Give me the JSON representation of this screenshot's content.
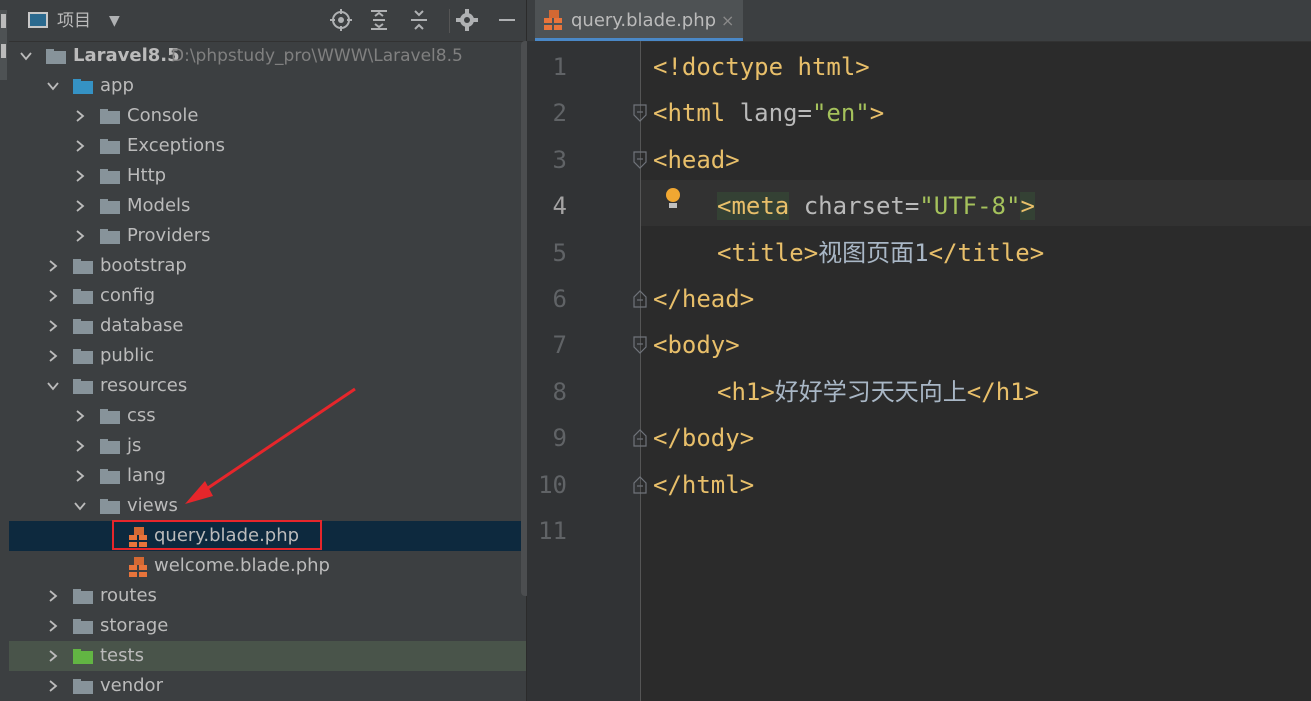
{
  "project_panel": {
    "title": "项目",
    "toolbar_icons": [
      "locate-icon",
      "expand-all-icon",
      "collapse-all-icon",
      "settings-icon",
      "hide-icon"
    ]
  },
  "tree": [
    {
      "label": "Laravel8.5",
      "path": "D:\\phpstudy_pro\\WWW\\Laravel8.5",
      "level": 0,
      "expanded": true,
      "icon": "folder",
      "bold": true
    },
    {
      "label": "app",
      "level": 1,
      "expanded": true,
      "icon": "folder-blue"
    },
    {
      "label": "Console",
      "level": 2,
      "expanded": false,
      "icon": "folder"
    },
    {
      "label": "Exceptions",
      "level": 2,
      "expanded": false,
      "icon": "folder"
    },
    {
      "label": "Http",
      "level": 2,
      "expanded": false,
      "icon": "folder"
    },
    {
      "label": "Models",
      "level": 2,
      "expanded": false,
      "icon": "folder"
    },
    {
      "label": "Providers",
      "level": 2,
      "expanded": false,
      "icon": "folder"
    },
    {
      "label": "bootstrap",
      "level": 1,
      "expanded": false,
      "icon": "folder"
    },
    {
      "label": "config",
      "level": 1,
      "expanded": false,
      "icon": "folder"
    },
    {
      "label": "database",
      "level": 1,
      "expanded": false,
      "icon": "folder"
    },
    {
      "label": "public",
      "level": 1,
      "expanded": false,
      "icon": "folder"
    },
    {
      "label": "resources",
      "level": 1,
      "expanded": true,
      "icon": "folder"
    },
    {
      "label": "css",
      "level": 2,
      "expanded": false,
      "icon": "folder"
    },
    {
      "label": "js",
      "level": 2,
      "expanded": false,
      "icon": "folder"
    },
    {
      "label": "lang",
      "level": 2,
      "expanded": false,
      "icon": "folder"
    },
    {
      "label": "views",
      "level": 2,
      "expanded": true,
      "icon": "folder"
    },
    {
      "label": "query.blade.php",
      "level": 3,
      "icon": "blade-file",
      "selected": true
    },
    {
      "label": "welcome.blade.php",
      "level": 3,
      "icon": "blade-file"
    },
    {
      "label": "routes",
      "level": 1,
      "expanded": false,
      "icon": "folder"
    },
    {
      "label": "storage",
      "level": 1,
      "expanded": false,
      "icon": "folder"
    },
    {
      "label": "tests",
      "level": 1,
      "expanded": false,
      "icon": "folder-green",
      "highlighted": true
    },
    {
      "label": "vendor",
      "level": 1,
      "expanded": false,
      "icon": "folder"
    }
  ],
  "editor": {
    "tab": {
      "label": "query.blade.php",
      "close": "×"
    },
    "current_line": 4,
    "lines": [
      {
        "n": "1",
        "fold": "",
        "indent": 0,
        "tokens": [
          {
            "t": "<!doctype html>",
            "c": "tag"
          }
        ]
      },
      {
        "n": "2",
        "fold": "open",
        "indent": 0,
        "tokens": [
          {
            "t": "<html ",
            "c": "tag"
          },
          {
            "t": "lang=",
            "c": "attr"
          },
          {
            "t": "\"en\"",
            "c": "val"
          },
          {
            "t": ">",
            "c": "tag"
          }
        ]
      },
      {
        "n": "3",
        "fold": "open",
        "indent": 0,
        "tokens": [
          {
            "t": "<head>",
            "c": "tag"
          }
        ]
      },
      {
        "n": "4",
        "fold": "",
        "indent": 1,
        "tokens": [
          {
            "t": "<meta",
            "c": "tag hl"
          },
          {
            "t": " charset=",
            "c": "attr"
          },
          {
            "t": "\"UTF-8\"",
            "c": "val"
          },
          {
            "t": ">",
            "c": "tag hl"
          }
        ]
      },
      {
        "n": "5",
        "fold": "",
        "indent": 1,
        "tokens": [
          {
            "t": "<title>",
            "c": "tag"
          },
          {
            "t": "视图页面1",
            "c": "text"
          },
          {
            "t": "</title>",
            "c": "tag"
          }
        ]
      },
      {
        "n": "6",
        "fold": "close",
        "indent": 0,
        "tokens": [
          {
            "t": "</head>",
            "c": "tag"
          }
        ]
      },
      {
        "n": "7",
        "fold": "open",
        "indent": 0,
        "tokens": [
          {
            "t": "<body>",
            "c": "tag"
          }
        ]
      },
      {
        "n": "8",
        "fold": "",
        "indent": 1,
        "tokens": [
          {
            "t": "<h1>",
            "c": "tag"
          },
          {
            "t": "好好学习天天向上",
            "c": "text"
          },
          {
            "t": "</h1>",
            "c": "tag"
          }
        ]
      },
      {
        "n": "9",
        "fold": "close",
        "indent": 0,
        "tokens": [
          {
            "t": "</body>",
            "c": "tag"
          }
        ]
      },
      {
        "n": "10",
        "fold": "close",
        "indent": 0,
        "tokens": [
          {
            "t": "</html>",
            "c": "tag"
          }
        ]
      },
      {
        "n": "11",
        "fold": "",
        "indent": 0,
        "tokens": []
      }
    ]
  },
  "colors": {
    "tag": "#e8bf6a",
    "attr": "#bababa",
    "value": "#a5c25c",
    "text": "#a9b7c6",
    "selection": "#0d293e",
    "annotation_red": "#e6262b"
  }
}
